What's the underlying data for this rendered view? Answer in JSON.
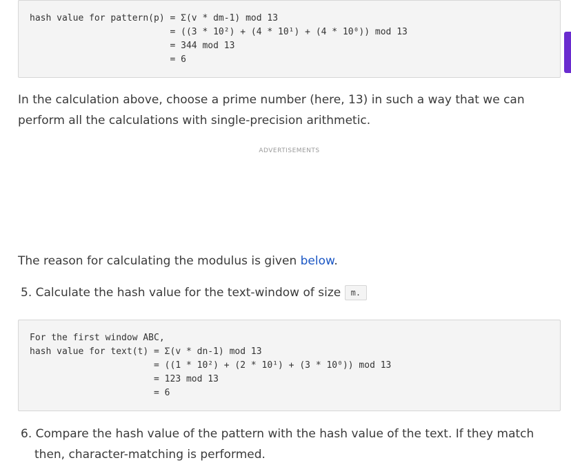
{
  "code_block_1": {
    "lines": "hash value for pattern(p) = Σ(v * dm-1) mod 13\n                          = ((3 * 10²) + (4 * 10¹) + (4 * 10⁰)) mod 13\n                          = 344 mod 13\n                          = 6"
  },
  "paragraph_1": {
    "text": "In the calculation above, choose a prime number (here, 13) in such a way that we can perform all the calculations with single-precision arithmetic."
  },
  "advertisement": {
    "label": "ADVERTISEMENTS"
  },
  "paragraph_2": {
    "text_before": "The reason for calculating the modulus is given ",
    "link_text": "below",
    "text_after": "."
  },
  "step_5": {
    "text": "5. Calculate the hash value for the text-window of size ",
    "code": "m."
  },
  "code_block_2": {
    "lines": "For the first window ABC,\nhash value for text(t) = Σ(v * dn-1) mod 13\n                       = ((1 * 10²) + (2 * 10¹) + (3 * 10⁰)) mod 13\n                       = 123 mod 13\n                       = 6"
  },
  "step_6": {
    "text": "6. Compare the hash value of the pattern with the hash value of the text. If they match then, character-matching is performed."
  },
  "colors": {
    "link": "#1a56c4",
    "side_tab": "#6a2ccf",
    "code_background": "#f4f4f4"
  }
}
